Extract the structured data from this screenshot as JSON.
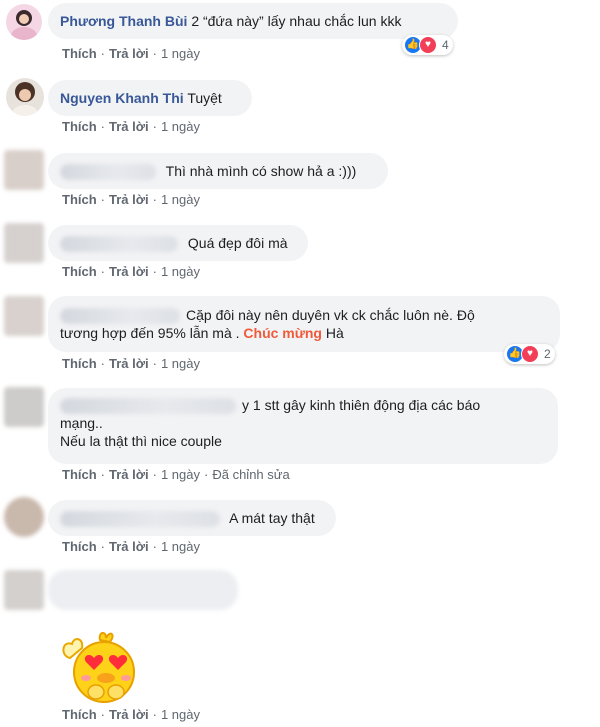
{
  "comments": [
    {
      "name": "Phương Thanh Bùi",
      "text": "2 “đứa này” lấy nhau chắc lun kkk",
      "like_label": "Thích",
      "reply_label": "Trả lời",
      "time": "1 ngày",
      "reaction_count": "4"
    },
    {
      "name": "Nguyen Khanh Thi",
      "text": "Tuyệt",
      "like_label": "Thích",
      "reply_label": "Trả lời",
      "time": "1 ngày"
    },
    {
      "text": "Thì nhà mình có show hả a :)))",
      "like_label": "Thích",
      "reply_label": "Trả lời",
      "time": "1 ngày"
    },
    {
      "text": "Quá đẹp đôi mà",
      "like_label": "Thích",
      "reply_label": "Trả lời",
      "time": "1 ngày"
    },
    {
      "text_line1": "Cặp đôi này nên duyên vk ck chắc luôn nè. Độ",
      "text_line2_pre": "tương hợp đến 95% lẫn mà .",
      "text_highlight": "Chúc mừng",
      "text_line2_post": "Hà",
      "like_label": "Thích",
      "reply_label": "Trả lời",
      "time": "1 ngày",
      "reaction_count": "2"
    },
    {
      "text_line1": "y 1 stt gây kinh thiên động địa các báo",
      "text_line2": "mạng..",
      "text_line3": "Nếu la thật thì nice couple",
      "like_label": "Thích",
      "reply_label": "Trả lời",
      "time": "1 ngày",
      "edited_label": "Đã chỉnh sửa"
    },
    {
      "text": "A mát tay thật",
      "like_label": "Thích",
      "reply_label": "Trả lời",
      "time": "1 ngày"
    },
    {
      "sticker": "heart-eyes-duck-sticker",
      "like_label": "Thích",
      "reply_label": "Trả lời",
      "time": "1 ngày"
    }
  ],
  "colors": {
    "name": "#385898",
    "bubble": "#f2f3f5",
    "meta": "#606770",
    "highlight": "#f05a3a",
    "like": "#1877f2",
    "love": "#f33e58"
  }
}
